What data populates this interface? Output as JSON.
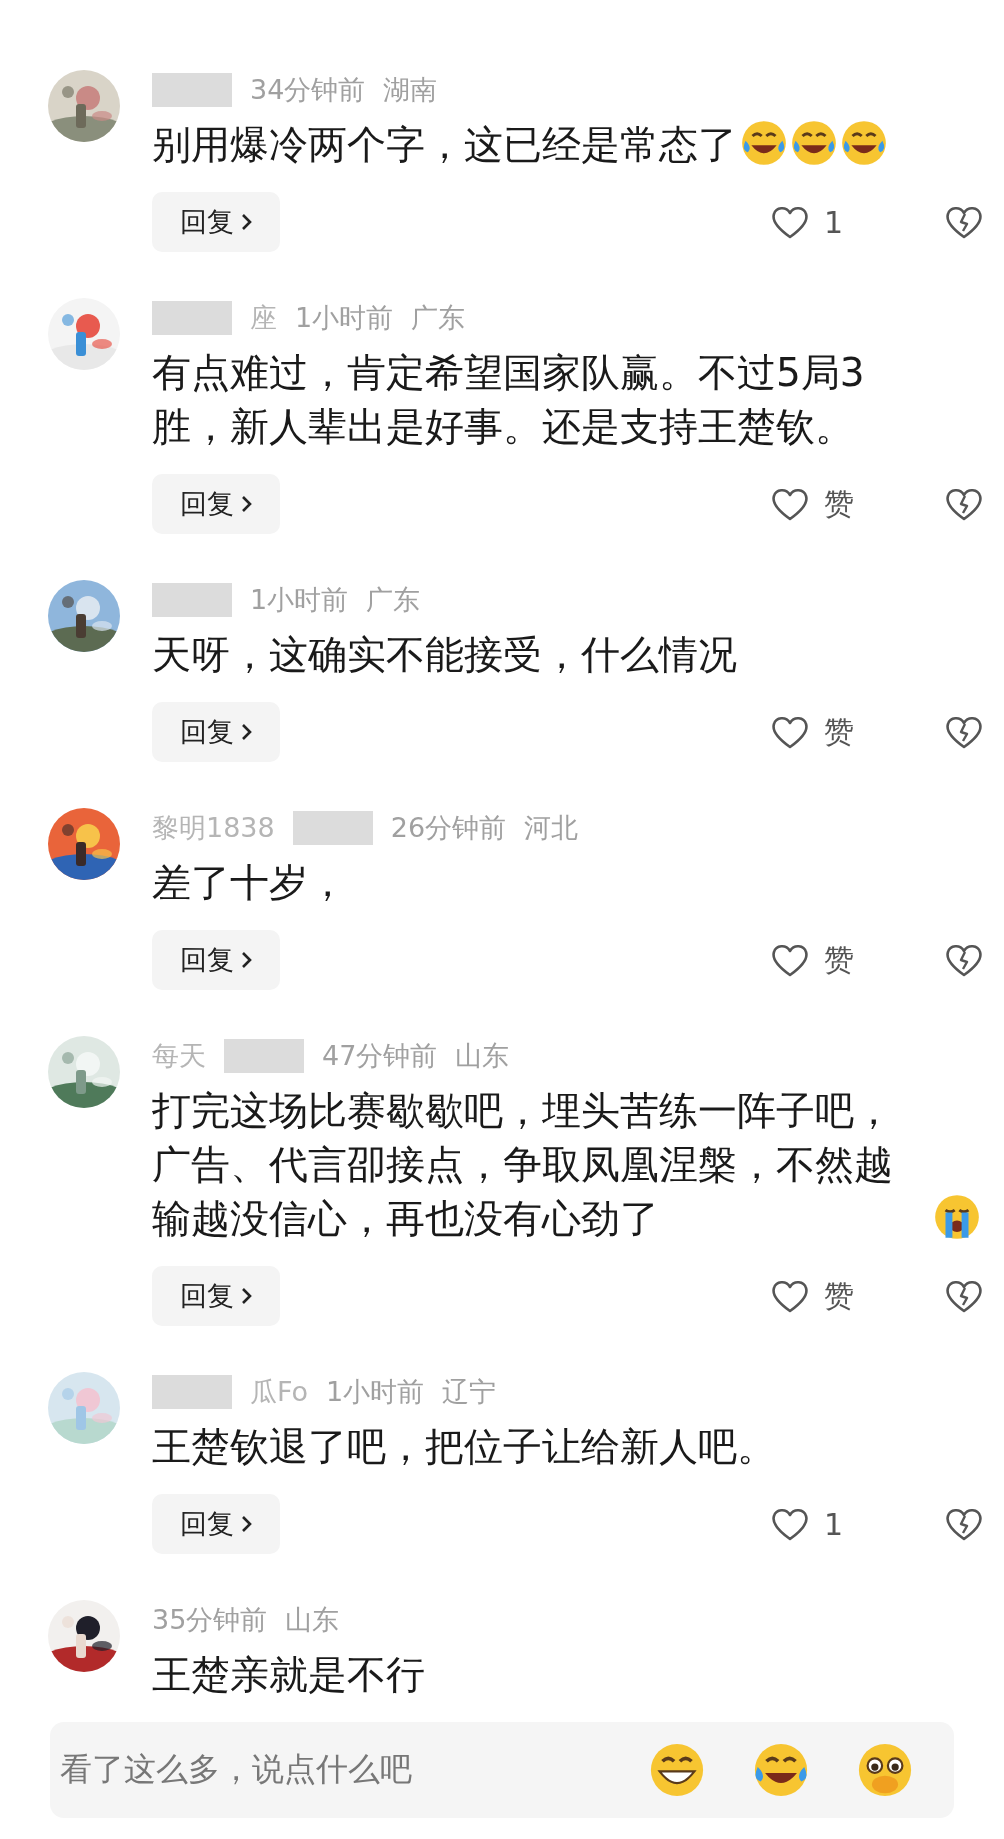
{
  "comments": [
    {
      "blur_before_name": false,
      "blur_after_name": true,
      "time": "34分钟前",
      "region": "湖南",
      "text": "别用爆冷两个字，这已经是常态了",
      "emojis": [
        {
          "kind": "tears-of-joy"
        },
        {
          "kind": "tears-of-joy"
        },
        {
          "kind": "tears-of-joy"
        }
      ],
      "reply": "回复",
      "likes": "1"
    },
    {
      "name": "座",
      "blur_before_name": true,
      "blur_after_name": false,
      "time": "1小时前",
      "region": "广东",
      "text": "有点难过，肯定希望国家队赢。不过5局3胜，新人辈出是好事。还是支持王楚钦。",
      "reply": "回复",
      "likes": "赞"
    },
    {
      "blur_before_name": false,
      "blur_after_name": true,
      "time": "1小时前",
      "region": "广东",
      "text": "天呀，这确实不能接受，什么情况",
      "reply": "回复",
      "likes": "赞"
    },
    {
      "name": "黎明1838",
      "blur_before_name": false,
      "blur_after_name": true,
      "time": "26分钟前",
      "region": "河北",
      "text": "差了十岁，",
      "reply": "回复",
      "likes": "赞"
    },
    {
      "name": "每天",
      "blur_before_name": false,
      "blur_after_name": true,
      "time": "47分钟前",
      "region": "山东",
      "text": "打完这场比赛歇歇吧，埋头苦练一阵子吧，广告、代言卲接点，争取凤凰涅槃，不然越输越没信心，再也没有心劲了",
      "emojis": [
        {
          "kind": "crying"
        }
      ],
      "reply": "回复",
      "likes": "赞"
    },
    {
      "name": "瓜Fo",
      "blur_before_name": true,
      "blur_after_name": false,
      "time": "1小时前",
      "region": "辽宁",
      "text": "王楚钦退了吧，把位子让给新人吧。",
      "reply": "回复",
      "likes": "1"
    },
    {
      "blur_before_name": false,
      "blur_after_name": false,
      "time": "35分钟前",
      "region": "山东",
      "text": "王楚亲就是不行"
    }
  ],
  "input": {
    "placeholder": "看了这么多，说点什么吧",
    "emojis": [
      {
        "kind": "grin"
      },
      {
        "kind": "tears-of-joy"
      },
      {
        "kind": "pleading"
      }
    ]
  }
}
